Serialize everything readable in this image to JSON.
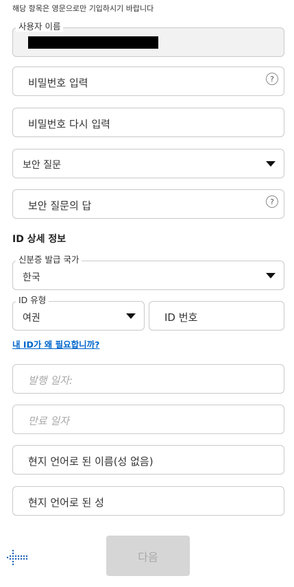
{
  "note": "해당 항목은 영문으로만 기입하시기 바랍니다",
  "username": {
    "legend": "사용자 이름"
  },
  "password": {
    "placeholder": "비밀번호 입력",
    "help": "?"
  },
  "password_confirm": {
    "placeholder": "비밀번호 다시 입력"
  },
  "security_question": {
    "placeholder": "보안 질문"
  },
  "security_answer": {
    "placeholder": "보안 질문의 답",
    "help": "?"
  },
  "id_section": {
    "title": "ID 상세 정보"
  },
  "issuing_country": {
    "legend": "신분증 발급 국가",
    "value": "한국"
  },
  "id_type": {
    "legend": "ID 유형",
    "value": "여권"
  },
  "id_number": {
    "placeholder": "ID 번호"
  },
  "why_id_link": "내 ID가 왜 필요합니까?",
  "issue_date": {
    "placeholder": "발행 일자:"
  },
  "expiry_date": {
    "placeholder": "만료 일자"
  },
  "local_given_name": {
    "placeholder": "현지 언어로 된 이름(성 없음)"
  },
  "local_surname": {
    "placeholder": "현지 언어로 된 성"
  },
  "next_button": "다음",
  "colors": {
    "link": "#0066cc",
    "brand": "#1a5fb4",
    "button_disabled": "#d6d6d6"
  }
}
